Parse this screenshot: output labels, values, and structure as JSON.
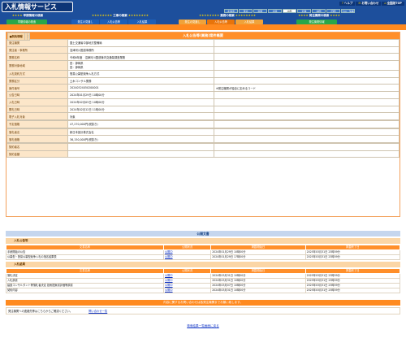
{
  "header": {
    "logo": "入札情報サービス",
    "links": [
      {
        "icon": "?",
        "label": "ヘルプ"
      },
      {
        "icon": "✉",
        "label": "お問い合わせ"
      },
      {
        "icon": "⌂",
        "label": "全国版TOP"
      }
    ],
    "regions": [
      {
        "label": "北海道",
        "on": false
      },
      {
        "label": "東北",
        "on": false
      },
      {
        "label": "関東",
        "on": false
      },
      {
        "label": "北陸",
        "on": false
      },
      {
        "label": "中部",
        "on": true
      },
      {
        "label": "近畿",
        "on": false
      },
      {
        "label": "中国",
        "on": false
      },
      {
        "label": "四国",
        "on": false
      },
      {
        "label": "九州・沖縄",
        "on": false
      }
    ]
  },
  "nav": {
    "groups": [
      {
        "title": "早期情報の検索",
        "tabs": [
          "早期情報の検索"
        ]
      },
      {
        "title": "工事の検索",
        "tabs": [
          "発注の見通し",
          "入札公告等",
          "入札結果"
        ]
      },
      {
        "title": "業務の検索",
        "tabs": [
          "発注の見通し",
          "入札公告等",
          "入札結果"
        ]
      },
      {
        "title": "発注機関の検索",
        "tabs": [
          "発注機関情報"
        ]
      }
    ]
  },
  "colors": {
    "orange": "#ff8f2a",
    "navy": "#1d4f9c",
    "blue_tab": "#1d5fb8",
    "green_tab": "#28a74a",
    "sel_tab": "#e8740a"
  },
  "main": {
    "title": "入札公告等(業務)案件概要",
    "rows": [
      {
        "k": "発注機関",
        "v": "国土交通省中部地方整備局"
      },
      {
        "k": "発注者・事務所",
        "v": "沼津河川国道事務所"
      },
      {
        "k": "業務名称",
        "v": "令和6年度　沼津河川国道管内交通量調査業務"
      },
      {
        "k": "業務対象地域",
        "v": "田：静岡県",
        "v2": "田：静岡県",
        "tall": true
      },
      {
        "k": "入札契約方式",
        "v": "簡易公募型競争入札方式"
      },
      {
        "k": "業務区分",
        "v": "土木コンサル業務"
      },
      {
        "k": "案件番号",
        "v": "20240524050200001",
        "note": "※発注機関が独自に定めるコード"
      },
      {
        "k": "公告日時",
        "v": "2024年01月29日 10時00分"
      },
      {
        "k": "入札日時",
        "v": "2024年02月05日 10時00分"
      },
      {
        "k": "開札日時",
        "v": "2024年02月12日 11時00分"
      },
      {
        "k": "電子入札対象",
        "v": "対象"
      },
      {
        "group": "■予定価格情報"
      },
      {
        "k": "予定価格",
        "v": "47,270,000円(税抜き)"
      },
      {
        "group": "■落札者情報"
      },
      {
        "k": "落札者名",
        "v": "新日本設計株式会社"
      },
      {
        "k": "落札価格",
        "v": "36,150,000円(税抜き)"
      },
      {
        "group": "■契約情報"
      },
      {
        "k": "契約者名",
        "v": ""
      },
      {
        "k": "契約金額",
        "v": ""
      }
    ]
  },
  "docs": {
    "title": "公開文書",
    "cols": [
      "文書名称",
      "公開状況",
      "掲載開始日",
      "掲載終了日"
    ],
    "sections": [
      {
        "name": "入札公告等",
        "rows": [
          {
            "name": "手続開始の公告",
            "status": "公開中",
            "start": "2024年01月29日 10時00分",
            "end": "2025年03月31日 23時59分"
          },
          {
            "name": "公募型・簡易公募型競争入札の指名結果表",
            "status": "公開中",
            "start": "2024年01月29日 17時00分",
            "end": "2025年03月31日 23時59分"
          }
        ]
      },
      {
        "name": "入札結果",
        "rows": [
          {
            "name": "落札決定",
            "status": "公開中",
            "start": "2024年03月31日 10時00分",
            "end": "2025年03月31日 23時59分"
          },
          {
            "name": "入札調書",
            "status": "公開中",
            "start": "2024年03月31日 10時00分",
            "end": "2025年03月31日 23時59分"
          },
          {
            "name": "建設コンサルタント等落札者決定 技術提案書評価等調書",
            "status": "公開中",
            "start": "2024年03月07日 10時00分",
            "end": "2025年03月31日 23時59分"
          },
          {
            "name": "契約内容",
            "status": "公開中",
            "start": "2024年03月31日 10時00分",
            "end": "2025年03月31日 23時59分"
          }
        ]
      }
    ]
  },
  "footer": {
    "bar": "内容に関するお問い合わせは各発注機関までお願い致します。",
    "note": "発注機関への連絡先等はこちらからご確認ください。",
    "contact_link": "問い合わせ一覧",
    "back": "検索結果一覧画面に戻る"
  }
}
